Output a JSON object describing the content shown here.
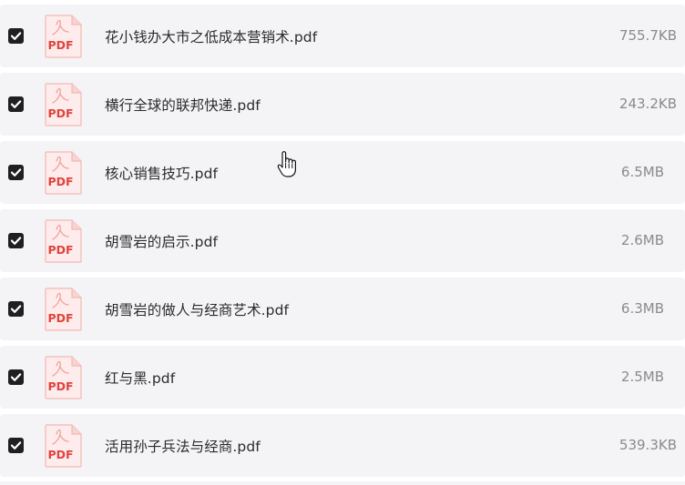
{
  "files": [
    {
      "name": "花小钱办大市之低成本营销术.pdf",
      "size": "755.7KB",
      "checked": true,
      "icon": "pdf-file-icon",
      "icon_text": "PDF"
    },
    {
      "name": "横行全球的联邦快递.pdf",
      "size": "243.2KB",
      "checked": true,
      "icon": "pdf-file-icon",
      "icon_text": "PDF"
    },
    {
      "name": "核心销售技巧.pdf",
      "size": "6.5MB",
      "checked": true,
      "icon": "pdf-file-icon",
      "icon_text": "PDF"
    },
    {
      "name": "胡雪岩的启示.pdf",
      "size": "2.6MB",
      "checked": true,
      "icon": "pdf-file-icon",
      "icon_text": "PDF"
    },
    {
      "name": "胡雪岩的做人与经商艺术.pdf",
      "size": "6.3MB",
      "checked": true,
      "icon": "pdf-file-icon",
      "icon_text": "PDF"
    },
    {
      "name": "红与黑.pdf",
      "size": "2.5MB",
      "checked": true,
      "icon": "pdf-file-icon",
      "icon_text": "PDF"
    },
    {
      "name": "活用孙子兵法与经商.pdf",
      "size": "539.3KB",
      "checked": true,
      "icon": "pdf-file-icon",
      "icon_text": "PDF"
    }
  ],
  "colors": {
    "row_background": "#f4f4f6",
    "checkbox_fill": "#1f1f1f",
    "pdf_red": "#e0443e",
    "text": "#2b2b2b",
    "size_text": "#8a8a8a"
  },
  "cursor": "hand-pointer-icon"
}
